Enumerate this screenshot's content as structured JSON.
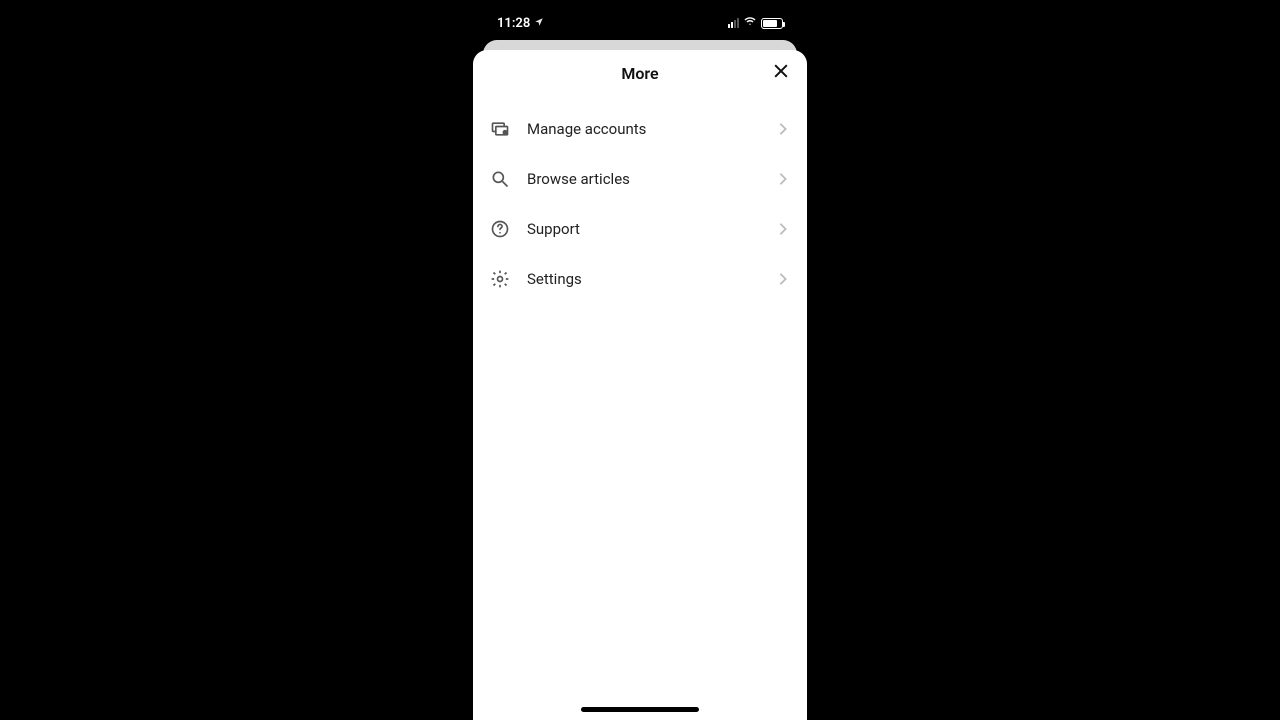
{
  "status": {
    "time": "11:28"
  },
  "sheet": {
    "title": "More"
  },
  "menu": {
    "items": [
      {
        "label": "Manage accounts",
        "icon": "manage-accounts-icon"
      },
      {
        "label": "Browse articles",
        "icon": "search-icon"
      },
      {
        "label": "Support",
        "icon": "help-icon"
      },
      {
        "label": "Settings",
        "icon": "gear-icon"
      }
    ]
  }
}
